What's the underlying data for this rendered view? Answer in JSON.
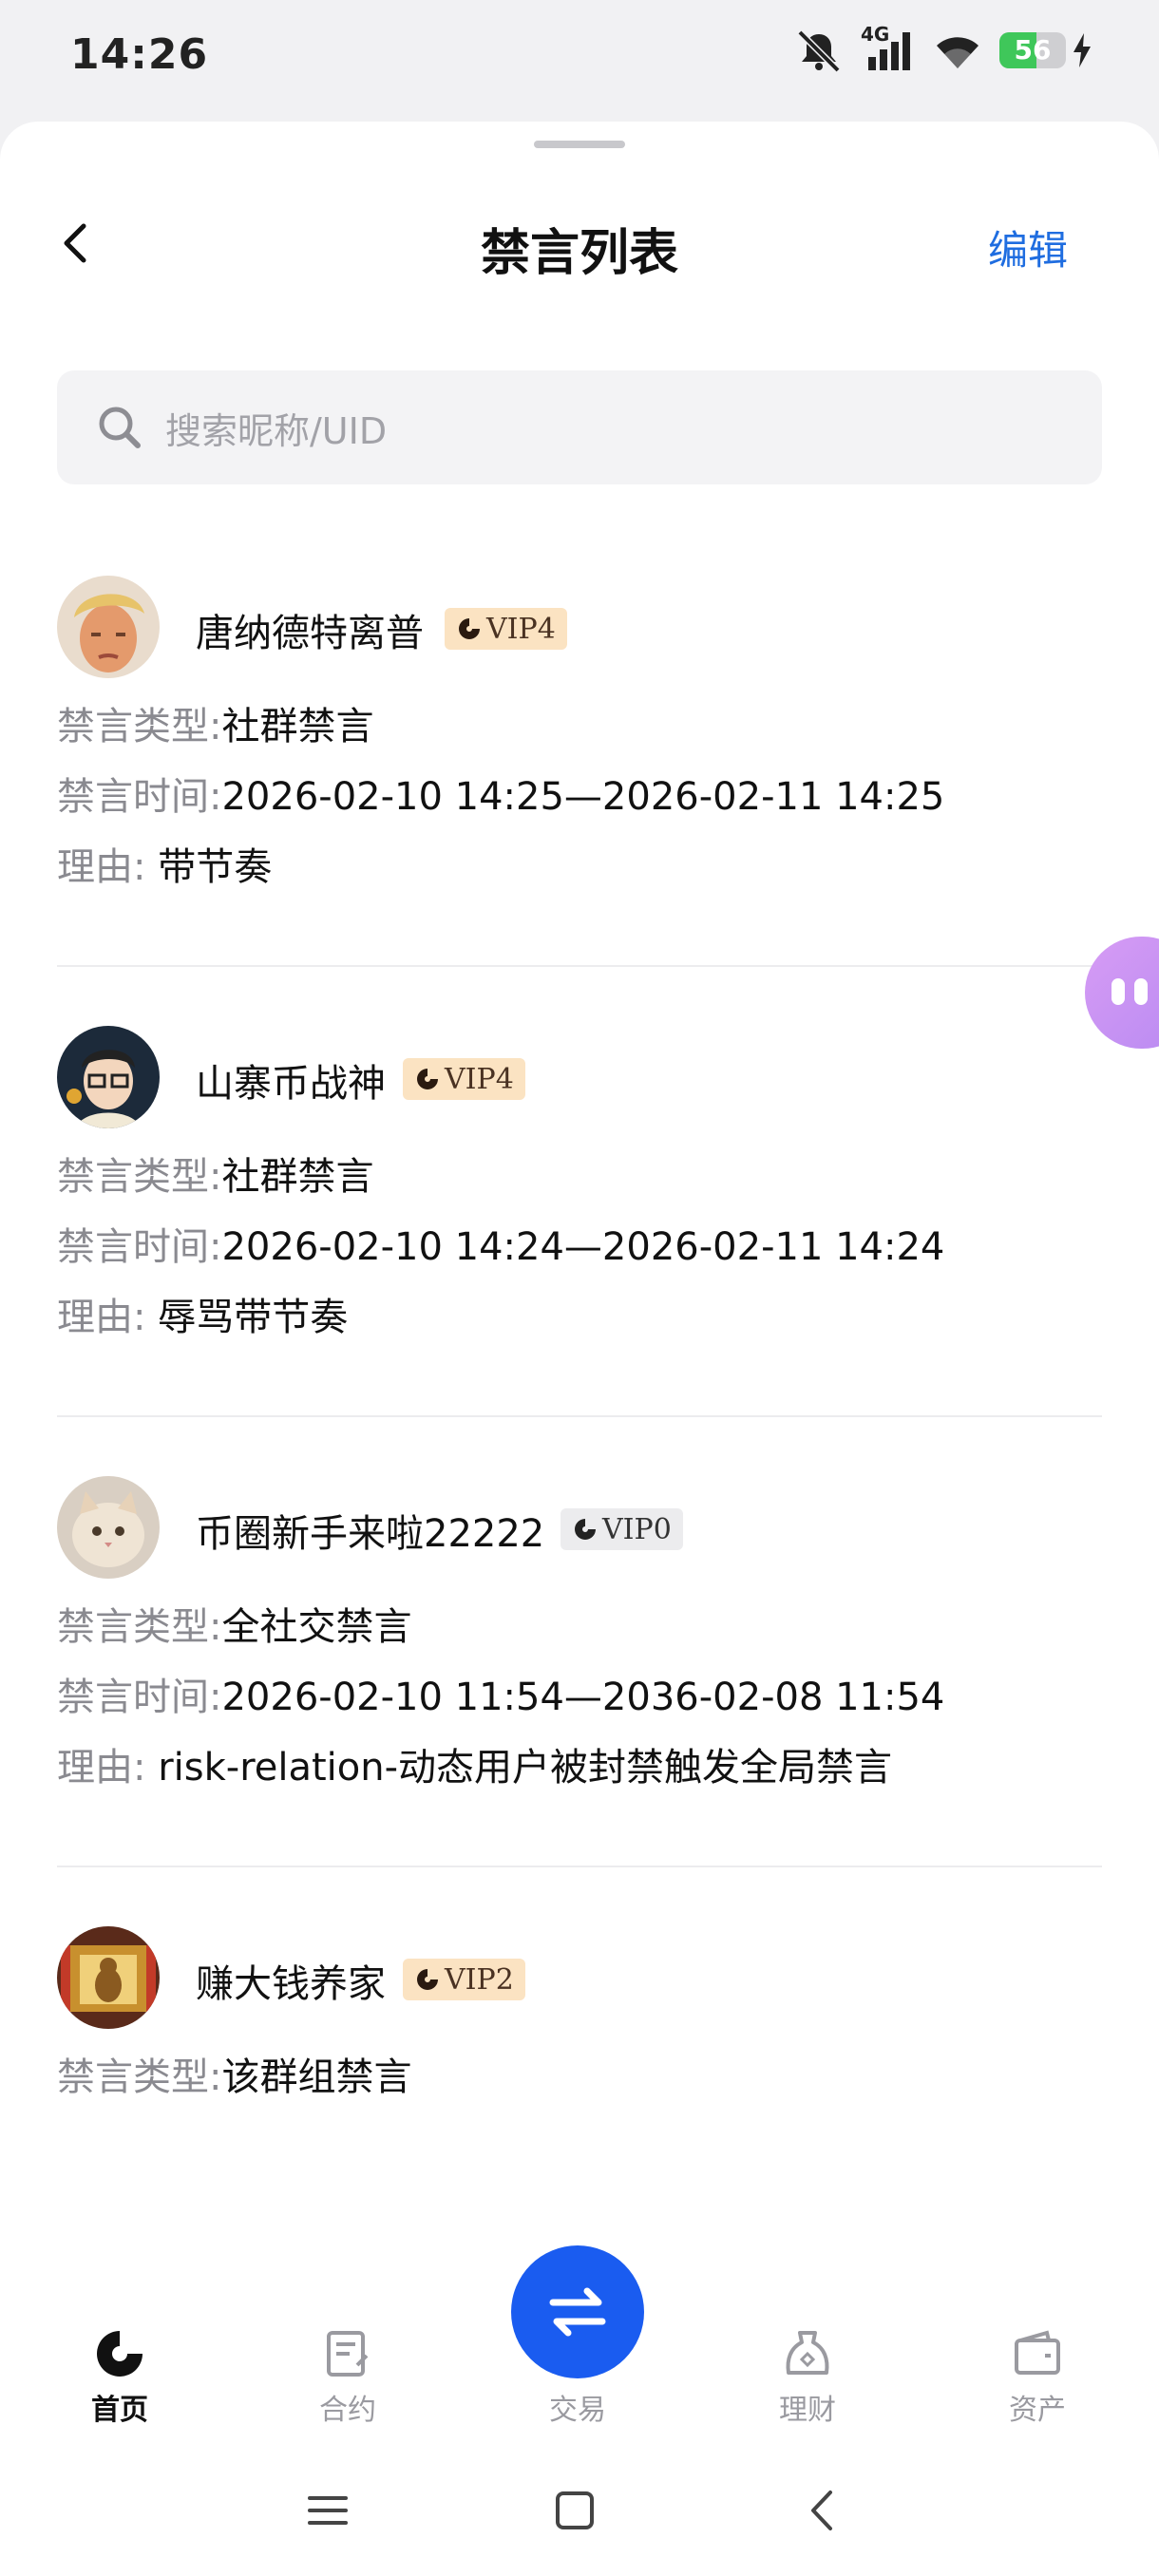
{
  "status": {
    "time": "14:26",
    "network": "4G",
    "battery": "56",
    "battery_level": 0.56
  },
  "header": {
    "title": "禁言列表",
    "edit_label": "编辑"
  },
  "search": {
    "placeholder": "搜索昵称/UID"
  },
  "labels": {
    "type": "禁言类型:",
    "time": "禁言时间:",
    "reason": "理由: "
  },
  "items": [
    {
      "name": "唐纳德特离普",
      "vip": "VIP4",
      "vip_style": "gold",
      "type": "社群禁言",
      "time": "2026-02-10 14:25—2026-02-11 14:25",
      "reason": "带节奏"
    },
    {
      "name": "山寨币战神",
      "vip": "VIP4",
      "vip_style": "gold",
      "type": "社群禁言",
      "time": "2026-02-10 14:24—2026-02-11 14:24",
      "reason": "辱骂带节奏"
    },
    {
      "name": "币圈新手来啦22222",
      "vip": "VIP0",
      "vip_style": "gray",
      "type": "全社交禁言",
      "time": "2026-02-10 11:54—2036-02-08 11:54",
      "reason": "risk-relation-动态用户被封禁触发全局禁言"
    },
    {
      "name": "赚大钱养家",
      "vip": "VIP2",
      "vip_style": "gold",
      "type": "该群组禁言"
    }
  ],
  "tabs": [
    {
      "label": "首页",
      "icon": "home-icon",
      "active": true
    },
    {
      "label": "合约",
      "icon": "contract-icon",
      "active": false
    },
    {
      "label": "交易",
      "icon": "trade-icon",
      "active": false
    },
    {
      "label": "理财",
      "icon": "finance-icon",
      "active": false
    },
    {
      "label": "资产",
      "icon": "wallet-icon",
      "active": false
    }
  ],
  "colors": {
    "accent": "#1a5cf0",
    "link": "#1f6de0",
    "vip_gold_bg": "#fbe3c2",
    "vip_gray_bg": "#ececee"
  }
}
